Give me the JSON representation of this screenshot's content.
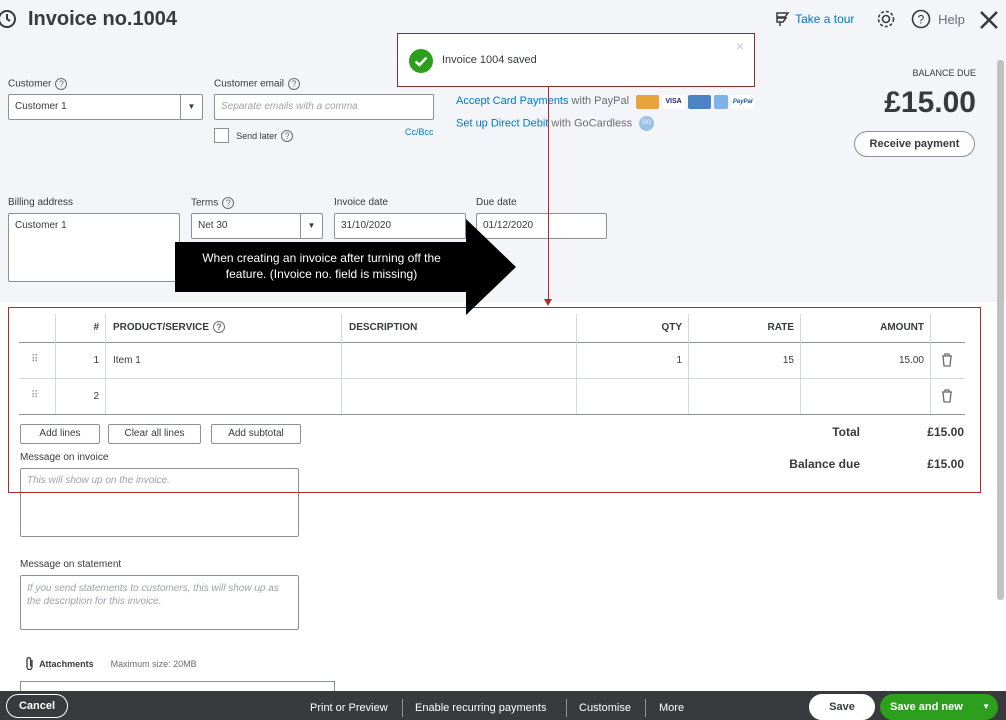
{
  "header": {
    "title": "Invoice no.1004",
    "take_a_tour": "Take a tour",
    "help": "Help"
  },
  "toast": {
    "message": "Invoice 1004 saved"
  },
  "customer": {
    "label": "Customer",
    "value": "Customer 1"
  },
  "customer_email": {
    "label": "Customer email",
    "placeholder": "Separate emails with a comma",
    "send_later": "Send later",
    "cc_bcc": "Cc/Bcc"
  },
  "payments": {
    "accept_cards_link": "Accept Card Payments",
    "accept_cards_suffix": " with PayPal",
    "direct_debit_link": "Set up Direct Debit",
    "direct_debit_suffix": " with GoCardless",
    "paypal": "PayPal",
    "visa": "VISA",
    "gocardless": "GO"
  },
  "balance": {
    "label": "BALANCE DUE",
    "amount": "£15.00",
    "receive_payment": "Receive payment"
  },
  "billing_address": {
    "label": "Billing address",
    "value": "Customer 1"
  },
  "terms": {
    "label": "Terms",
    "value": "Net 30"
  },
  "invoice_date": {
    "label": "Invoice date",
    "value": "31/10/2020"
  },
  "due_date": {
    "label": "Due date",
    "value": "01/12/2020"
  },
  "annotation": {
    "line1": "When creating an invoice  after turning off the",
    "line2": "feature. (Invoice no. field is missing)"
  },
  "table": {
    "headers": {
      "num": "#",
      "product": "PRODUCT/SERVICE",
      "description": "DESCRIPTION",
      "qty": "QTY",
      "rate": "RATE",
      "amount": "AMOUNT"
    },
    "rows": [
      {
        "num": "1",
        "product": "Item 1",
        "description": "",
        "qty": "1",
        "rate": "15",
        "amount": "15.00"
      },
      {
        "num": "2",
        "product": "",
        "description": "",
        "qty": "",
        "rate": "",
        "amount": ""
      }
    ]
  },
  "table_buttons": {
    "add_lines": "Add lines",
    "clear_all_lines": "Clear all lines",
    "add_subtotal": "Add subtotal"
  },
  "totals": {
    "total_label": "Total",
    "total_value": "£15.00",
    "balance_due_label": "Balance due",
    "balance_due_value": "£15.00"
  },
  "message_invoice": {
    "label": "Message on invoice",
    "placeholder": "This will show up on the invoice."
  },
  "message_statement": {
    "label": "Message on statement",
    "placeholder": "If you send statements to customers, this will show up as the description for this invoice."
  },
  "attachments": {
    "label": "Attachments",
    "max_size": "Maximum size: 20MB"
  },
  "footer": {
    "cancel": "Cancel",
    "print_preview": "Print or Preview",
    "enable_recurring": "Enable recurring payments",
    "customise": "Customise",
    "more": "More",
    "save": "Save",
    "save_and_new": "Save and new"
  },
  "colors": {
    "brand_green": "#2ca01c",
    "link_blue": "#0077c5",
    "annotation_red": "#b02a2a",
    "footer_bg": "#393a3d"
  }
}
